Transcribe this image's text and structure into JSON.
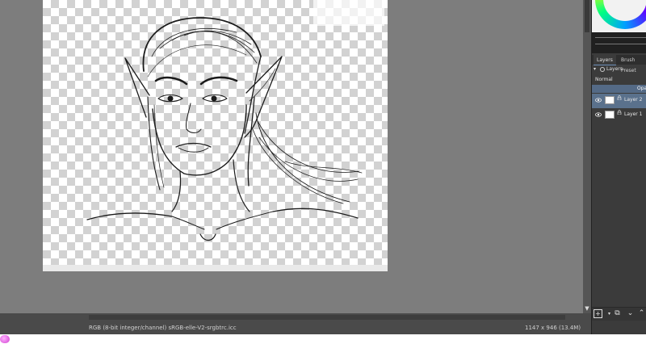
{
  "status_bar": {
    "color_profile": "RGB (8-bit integer/channel)  sRGB-elle-V2-srgbtrc.icc",
    "image_size": "1147 x 946 (13.4M)"
  },
  "dock": {
    "tabs": [
      {
        "label": "Layers"
      },
      {
        "label": "Brush Preset"
      }
    ],
    "layers_title": "Layers",
    "blend_mode": "Normal",
    "opacity_label": "Opa",
    "layers": [
      {
        "name": "Layer 2",
        "selected": true
      },
      {
        "name": "Layer 1",
        "selected": false
      }
    ]
  },
  "icons": {
    "add": "plus-icon",
    "duplicate": "duplicate-icon",
    "move_down": "chevron-down-icon",
    "move_up": "chevron-up-icon",
    "visible": "eye-icon",
    "lock": "lock-icon"
  },
  "colors": {
    "selection": "#5a718c",
    "canvas_bg": "#7d7d7d",
    "panel_bg": "#3b3b3b"
  }
}
